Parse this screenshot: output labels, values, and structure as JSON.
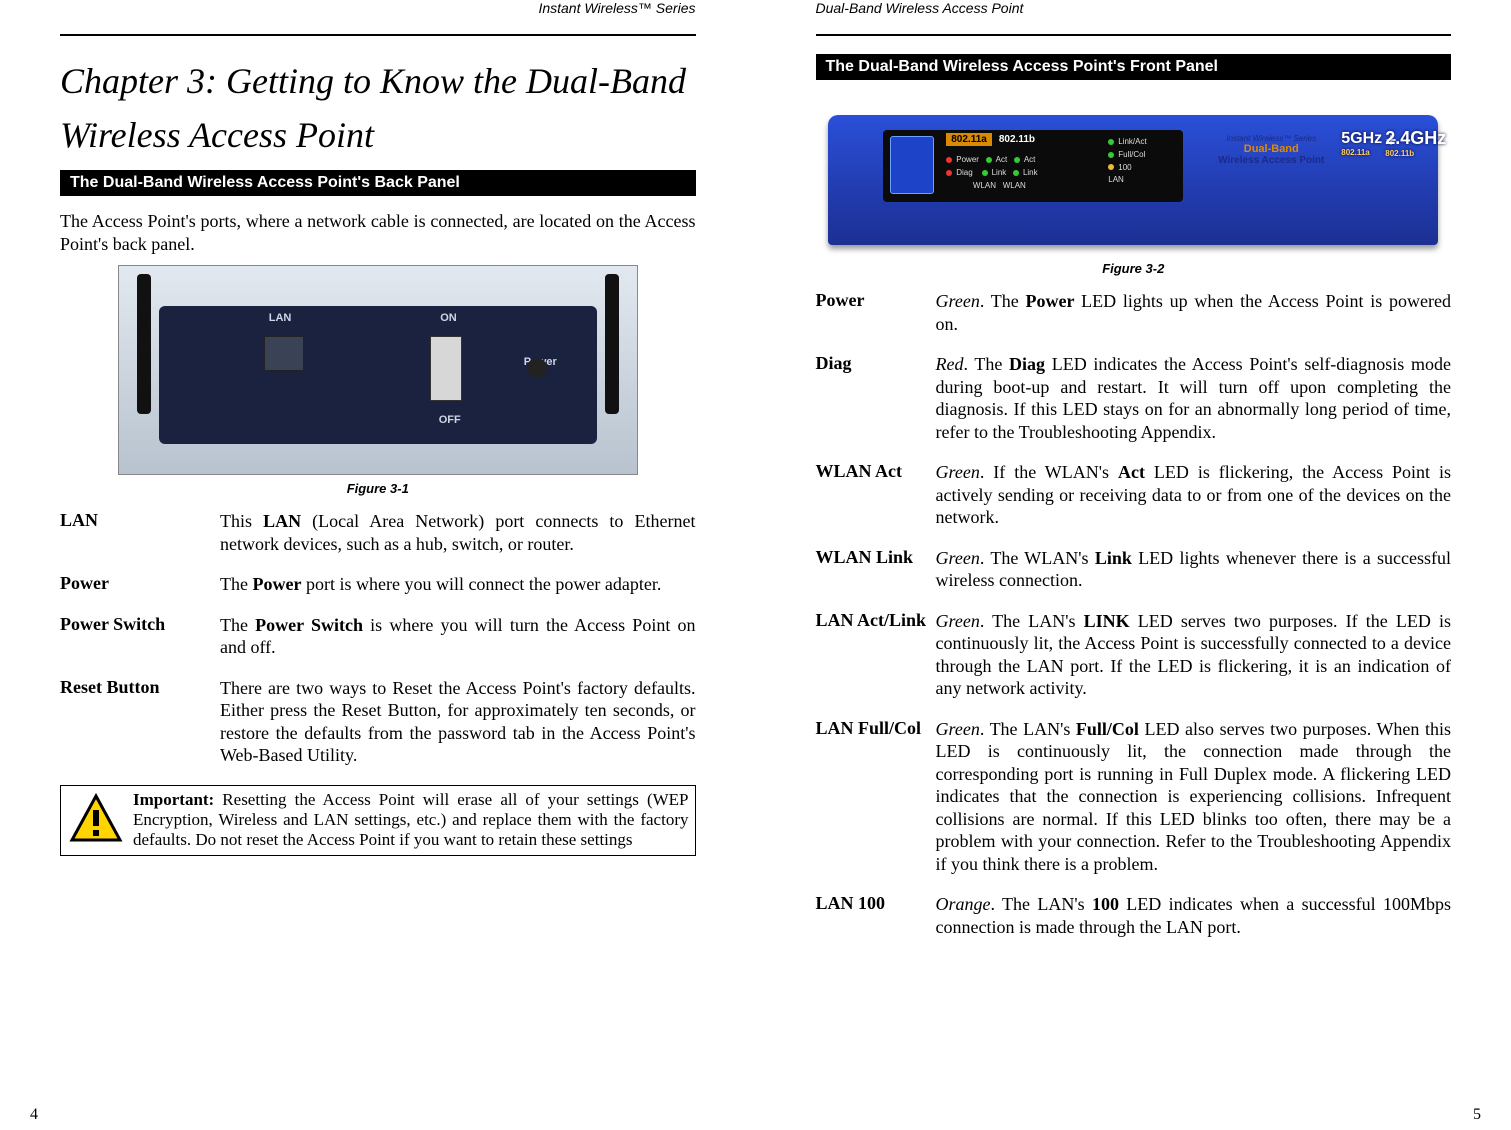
{
  "left": {
    "running_head": "Instant Wireless™ Series",
    "chapter_title": "Chapter 3: Getting to Know the Dual-Band Wireless Access Point",
    "section_bar": "The Dual-Band Wireless Access Point's Back Panel",
    "intro": "The Access Point's ports, where a network cable is connected, are located on the Access Point's back panel.",
    "device_labels": {
      "lan": "LAN",
      "on": "ON",
      "off": "OFF",
      "power": "Power"
    },
    "figure_caption": "Figure 3-1",
    "defs": [
      {
        "term": "LAN",
        "desc_pre": "This ",
        "desc_bold": "LAN",
        "desc_post": " (Local Area Network) port connects to Ethernet network devices, such as a hub, switch, or router."
      },
      {
        "term": "Power",
        "desc_pre": "The ",
        "desc_bold": "Power",
        "desc_post": " port is where you will connect the  power adapter."
      },
      {
        "term": "Power Switch",
        "desc_pre": "The ",
        "desc_bold": "Power Switch",
        "desc_post": " is where you will turn the Access Point on and off."
      },
      {
        "term": "Reset Button",
        "desc_plain": "There are two ways to Reset the Access Point's factory defaults. Either press the Reset Button, for approximately ten seconds, or restore the defaults from the password tab in the Access Point's Web-Based Utility."
      }
    ],
    "important_label": "Important:",
    "important_body": " Resetting the Access Point will erase all of your settings (WEP Encryption, Wireless and LAN settings, etc.) and replace them with the factory defaults. Do not reset the Access Point if you want to retain these settings",
    "page_number": "4"
  },
  "right": {
    "running_head": "Dual-Band Wireless Access Point",
    "section_bar": "The Dual-Band Wireless Access Point's Front Panel",
    "figure_caption": "Figure 3-2",
    "device": {
      "band_a": "802.11a",
      "band_b": "802.11b",
      "info_line1": "Instant Wireless™ Series",
      "info_line2": "Dual-Band",
      "info_line3": "Wireless Access Point",
      "ghz5_top": "5GHz",
      "ghz5_bot": "802.11a",
      "plus": "+",
      "ghz24_top": "2.4GHz",
      "ghz24_bot": "802.11b",
      "panel_power": "Power",
      "panel_diag": "Diag",
      "panel_act": "Act",
      "panel_link": "Link",
      "panel_wlan": "WLAN",
      "panel_wlan2": "WLAN",
      "led_linkact": "Link/Act",
      "led_fullcol": "Full/Col",
      "led_100": "100",
      "led_lan": "LAN"
    },
    "defs": [
      {
        "term": "Power",
        "desc_ital": "Green",
        "desc_mid1": ". The ",
        "desc_bold": "Power",
        "desc_mid2": " LED lights up when the Access Point is powered on."
      },
      {
        "term": "Diag",
        "desc_ital": "Red",
        "desc_mid1": ". The ",
        "desc_bold": "Diag",
        "desc_mid2": " LED indicates the Access Point's self-diagnosis mode during boot-up and restart. It will turn off upon completing the diagnosis. If this LED stays on for an abnormally long period of time, refer to the Troubleshooting Appendix."
      },
      {
        "term": "WLAN Act",
        "desc_ital": "Green",
        "desc_mid1": ". If the WLAN's ",
        "desc_bold": "Act",
        "desc_mid2": " LED is flickering, the Access Point is actively sending or receiving data to or from one of the devices on the network."
      },
      {
        "term": "WLAN Link",
        "desc_ital": "Green",
        "desc_mid1": ". The WLAN's ",
        "desc_bold": "Link",
        "desc_mid2": " LED lights whenever there is a successful wireless connection."
      },
      {
        "term": "LAN Act/Link",
        "desc_ital": "Green",
        "desc_mid1": ". The LAN's ",
        "desc_bold": "LINK",
        "desc_mid2": " LED serves two purposes. If the LED is continuously lit, the Access Point is successfully connected to a device through the LAN port. If the LED is flickering, it is an indication of any network activity."
      },
      {
        "term": "LAN Full/Col",
        "desc_ital": "Green",
        "desc_mid1": ". The LAN's ",
        "desc_bold": "Full/Col",
        "desc_mid2": " LED also serves two purposes. When this LED is continuously lit, the connection made through the corresponding port is running in Full Duplex mode. A flickering LED indicates that the connection is experiencing collisions. Infrequent collisions are normal. If this LED blinks too often, there may be a problem with your connection. Refer to the Troubleshooting Appendix if you think there is a problem."
      },
      {
        "term": "LAN 100",
        "desc_ital": "Orange",
        "desc_mid1": ". The LAN's ",
        "desc_bold": "100",
        "desc_mid2": " LED indicates when a successful 100Mbps connection is made through the LAN port."
      }
    ],
    "page_number": "5"
  }
}
